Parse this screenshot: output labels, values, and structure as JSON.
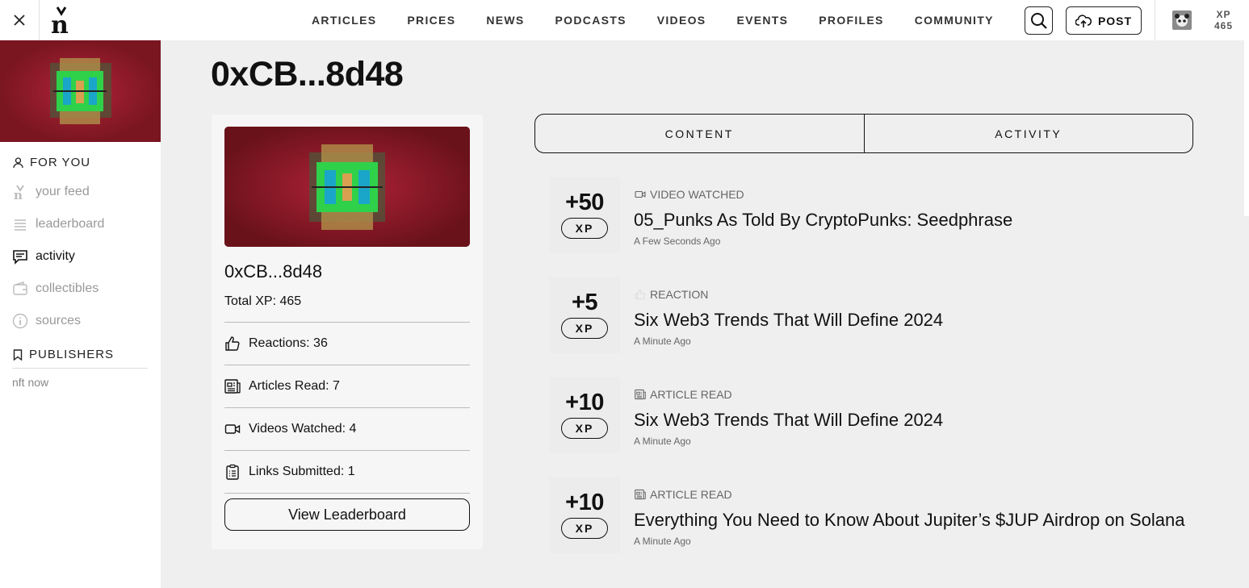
{
  "app": {
    "logo_glyph": "n"
  },
  "nav": {
    "items": [
      "ARTICLES",
      "PRICES",
      "NEWS",
      "PODCASTS",
      "VIDEOS",
      "EVENTS",
      "PROFILES",
      "COMMUNITY"
    ]
  },
  "header": {
    "post_label": "POST",
    "xp_label": "XP",
    "xp_value": "465"
  },
  "sidebar": {
    "for_you_label": "FOR YOU",
    "items": [
      {
        "label": "your feed",
        "icon": "n-logo-icon"
      },
      {
        "label": "leaderboard",
        "icon": "list-icon"
      },
      {
        "label": "activity",
        "icon": "chat-icon"
      },
      {
        "label": "collectibles",
        "icon": "wallet-icon"
      },
      {
        "label": "sources",
        "icon": "info-icon"
      }
    ],
    "active_item": "activity",
    "publishers_label": "PUBLISHERS",
    "publishers": [
      "nft now"
    ]
  },
  "page": {
    "title": "0xCB...8d48"
  },
  "profile": {
    "name": "0xCB...8d48",
    "total_xp": "Total XP: 465",
    "stats": [
      {
        "label": "Reactions: 36",
        "icon": "thumbs-up-icon"
      },
      {
        "label": "Articles Read: 7",
        "icon": "newspaper-icon"
      },
      {
        "label": "Videos Watched: 4",
        "icon": "video-icon"
      },
      {
        "label": "Links Submitted: 1",
        "icon": "clipboard-icon"
      }
    ],
    "leaderboard_button": "View Leaderboard"
  },
  "tabs": [
    "CONTENT",
    "ACTIVITY"
  ],
  "activity": [
    {
      "xp": "+50",
      "xp_unit": "XP",
      "type": "VIDEO WATCHED",
      "icon": "video-icon",
      "title": "05_Punks As Told By CryptoPunks: Seedphrase",
      "time": "A Few Seconds Ago"
    },
    {
      "xp": "+5",
      "xp_unit": "XP",
      "type": "REACTION",
      "icon": "thumbs-up-icon",
      "title": "Six Web3 Trends That Will Define 2024",
      "time": "A Minute Ago"
    },
    {
      "xp": "+10",
      "xp_unit": "XP",
      "type": "ARTICLE READ",
      "icon": "newspaper-icon",
      "title": "Six Web3 Trends That Will Define 2024",
      "time": "A Minute Ago"
    },
    {
      "xp": "+10",
      "xp_unit": "XP",
      "type": "ARTICLE READ",
      "icon": "newspaper-icon",
      "title": "Everything You Need to Know About Jupiter’s $JUP Airdrop on Solana",
      "time": "A Minute Ago"
    }
  ],
  "colors": {
    "banner_red": "#9a1b25",
    "nft_green": "#2fd14a",
    "nft_blue": "#1aa6c9"
  }
}
